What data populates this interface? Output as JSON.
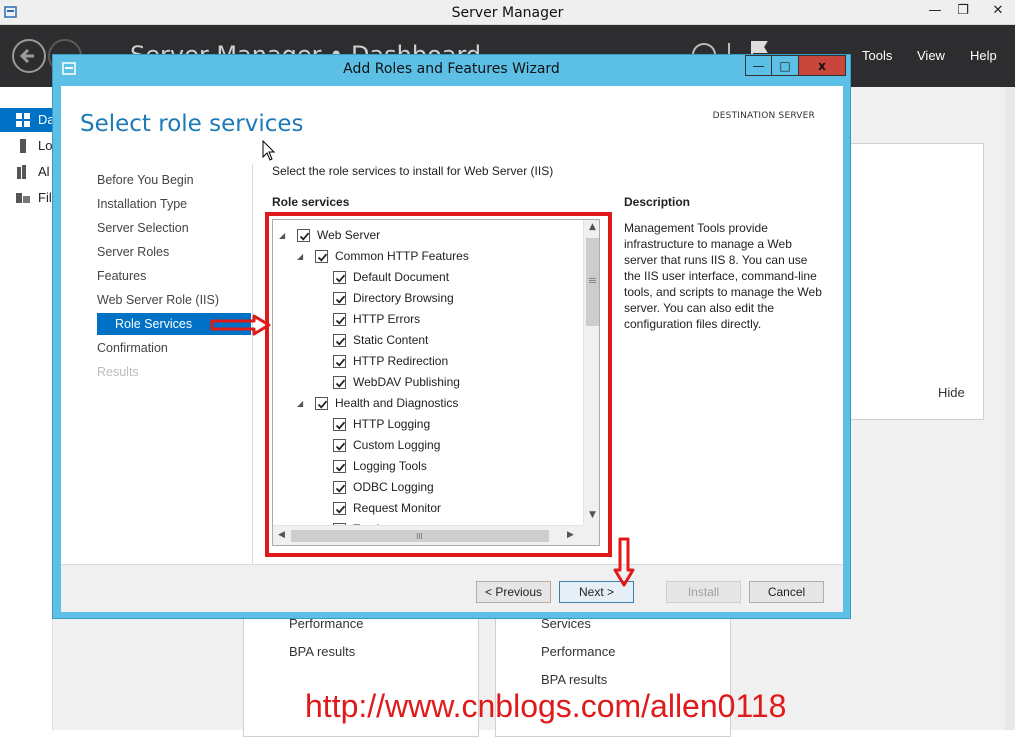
{
  "server_manager": {
    "title": "Server Manager",
    "header_breadcrumb": "Server Manager • Dashboard",
    "menu": [
      "Tools",
      "View",
      "Help"
    ],
    "sidebar": [
      {
        "label": "Dashboard",
        "short": "Da",
        "icon": "dashboard-icon",
        "active": true
      },
      {
        "label": "Local Server",
        "short": "Lo",
        "icon": "server-icon",
        "active": false
      },
      {
        "label": "All Servers",
        "short": "Al",
        "icon": "servers-icon",
        "active": false
      },
      {
        "label": "File and Storage Services",
        "short": "Fil",
        "icon": "storage-icon",
        "active": false
      }
    ],
    "hide_label": "Hide",
    "tile1": [
      "Performance",
      "BPA results"
    ],
    "tile2": [
      "Services",
      "Performance",
      "BPA results"
    ]
  },
  "wizard": {
    "title": "Add Roles and Features Wizard",
    "heading": "Select role services",
    "destination_label": "DESTINATION SERVER",
    "instruction": "Select the role services to install for Web Server (IIS)",
    "role_services_header": "Role services",
    "description_header": "Description",
    "description": "Management Tools provide infrastructure to manage a Web server that runs IIS 8. You can use the IIS user interface, command-line tools, and scripts to manage the Web server. You can also edit the configuration files directly.",
    "steps": [
      {
        "label": "Before You Begin",
        "state": "normal"
      },
      {
        "label": "Installation Type",
        "state": "normal"
      },
      {
        "label": "Server Selection",
        "state": "normal"
      },
      {
        "label": "Server Roles",
        "state": "normal"
      },
      {
        "label": "Features",
        "state": "normal"
      },
      {
        "label": "Web Server Role (IIS)",
        "state": "normal"
      },
      {
        "label": "Role Services",
        "state": "active"
      },
      {
        "label": "Confirmation",
        "state": "normal"
      },
      {
        "label": "Results",
        "state": "disabled"
      }
    ],
    "tree": [
      {
        "label": "Web Server",
        "level": 0,
        "expandable": true,
        "checked": true
      },
      {
        "label": "Common HTTP Features",
        "level": 1,
        "expandable": true,
        "checked": true
      },
      {
        "label": "Default Document",
        "level": 2,
        "expandable": false,
        "checked": true
      },
      {
        "label": "Directory Browsing",
        "level": 2,
        "expandable": false,
        "checked": true
      },
      {
        "label": "HTTP Errors",
        "level": 2,
        "expandable": false,
        "checked": true
      },
      {
        "label": "Static Content",
        "level": 2,
        "expandable": false,
        "checked": true
      },
      {
        "label": "HTTP Redirection",
        "level": 2,
        "expandable": false,
        "checked": true
      },
      {
        "label": "WebDAV Publishing",
        "level": 2,
        "expandable": false,
        "checked": true
      },
      {
        "label": "Health and Diagnostics",
        "level": 1,
        "expandable": true,
        "checked": true
      },
      {
        "label": "HTTP Logging",
        "level": 2,
        "expandable": false,
        "checked": true
      },
      {
        "label": "Custom Logging",
        "level": 2,
        "expandable": false,
        "checked": true
      },
      {
        "label": "Logging Tools",
        "level": 2,
        "expandable": false,
        "checked": true
      },
      {
        "label": "ODBC Logging",
        "level": 2,
        "expandable": false,
        "checked": true
      },
      {
        "label": "Request Monitor",
        "level": 2,
        "expandable": false,
        "checked": true
      },
      {
        "label": "Tracing",
        "level": 2,
        "expandable": false,
        "checked": true
      }
    ],
    "buttons": {
      "previous": "< Previous",
      "next": "Next >",
      "install": "Install",
      "cancel": "Cancel"
    }
  },
  "annotation": {
    "watermark": "http://www.cnblogs.com/allen0118",
    "highlight_color": "#e01a1a"
  }
}
